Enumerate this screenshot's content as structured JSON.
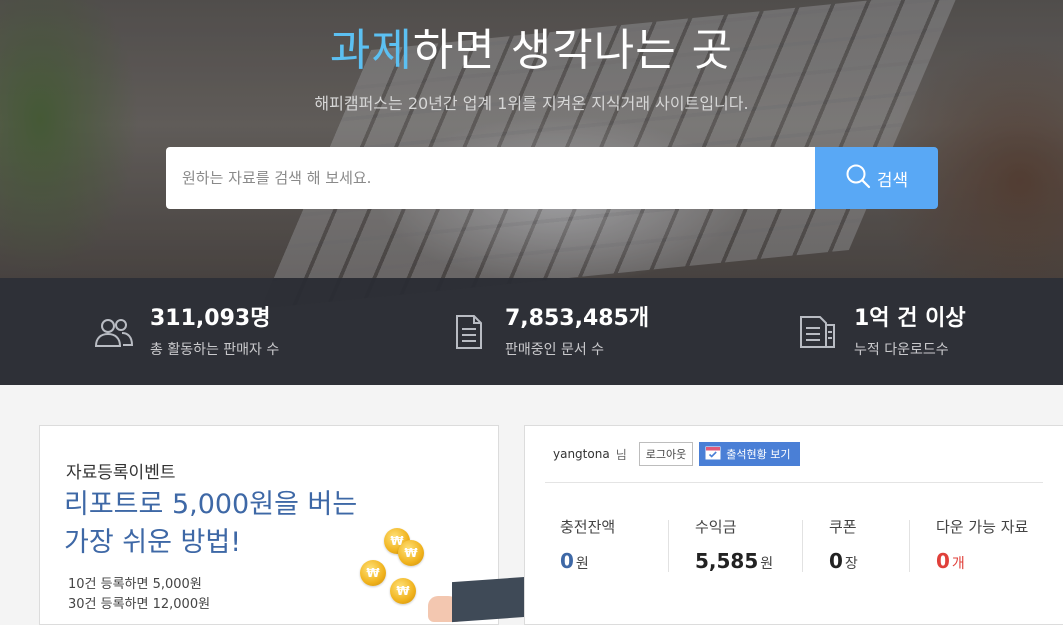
{
  "hero": {
    "title_accent": "과제",
    "title_rest": "하면 생각나는 곳",
    "subtitle": "해피캠퍼스는 20년간 업계 1위를 지켜온 지식거래 사이트입니다.",
    "search": {
      "placeholder": "원하는 자료를 검색 해 보세요.",
      "button_label": "검색",
      "button_color": "#59a8f5"
    }
  },
  "stats": [
    {
      "value": "311,093명",
      "label": "총 활동하는 판매자 수",
      "icon": "users-icon"
    },
    {
      "value": "7,853,485개",
      "label": "판매중인 문서 수",
      "icon": "document-icon"
    },
    {
      "value": "1억 건 이상",
      "label": "누적 다운로드수",
      "icon": "documents-icon"
    }
  ],
  "event": {
    "tag": "자료등록이벤트",
    "headline_line1": "리포트로 5,000원을 버는",
    "headline_line2": "가장 쉬운 방법!",
    "lines": [
      "10건 등록하면 5,000원",
      "30건 등록하면 12,000원"
    ],
    "coin_symbol": "₩"
  },
  "account": {
    "username": "yangtona",
    "suffix": "님",
    "logout_label": "로그아웃",
    "attendance_label": "출석현황 보기",
    "metrics": [
      {
        "label": "충전잔액",
        "value": "0",
        "unit": "원",
        "color": "#3e68a6"
      },
      {
        "label": "수익금",
        "value": "5,585",
        "unit": "원",
        "color": "#222222"
      },
      {
        "label": "쿠폰",
        "value": "0",
        "unit": "장",
        "color": "#222222"
      },
      {
        "label": "다운 가능 자료",
        "value": "0",
        "unit": "개",
        "color": "#e0403a"
      }
    ]
  }
}
